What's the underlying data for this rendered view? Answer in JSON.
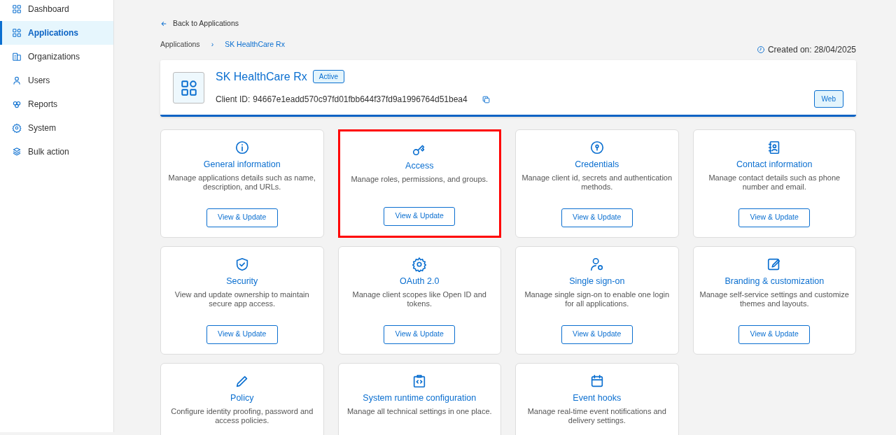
{
  "sidebar": {
    "items": [
      {
        "label": "Dashboard",
        "selected": false
      },
      {
        "label": "Applications",
        "selected": true
      },
      {
        "label": "Organizations",
        "selected": false
      },
      {
        "label": "Users",
        "selected": false
      },
      {
        "label": "Reports",
        "selected": false
      },
      {
        "label": "System",
        "selected": false
      },
      {
        "label": "Bulk action",
        "selected": false
      }
    ]
  },
  "back_link": "Back to Applications",
  "breadcrumb": [
    "Applications",
    "SK HealthCare Rx"
  ],
  "breadcrumb_separator": "›",
  "created_on": "Created on: 28/04/2025",
  "app": {
    "name": "SK HealthCare Rx",
    "status": "Active",
    "client_id_label": "Client ID:",
    "client_id": "94667e1eadd570c97fd01fbb644f37fd9a1996764d51bea4",
    "type": "Web"
  },
  "tiles": [
    {
      "title": "General information",
      "description": "Manage applications details such as name, description, and URLs.",
      "button": "View & Update",
      "highlighted": false
    },
    {
      "title": "Access",
      "description": "Manage roles, permissions, and groups.",
      "button": "View & Update",
      "highlighted": true
    },
    {
      "title": "Credentials",
      "description": "Manage client id, secrets and authentication methods.",
      "button": "View & Update",
      "highlighted": false
    },
    {
      "title": "Contact information",
      "description": "Manage contact details such as phone number and email.",
      "button": "View & Update",
      "highlighted": false
    },
    {
      "title": "Security",
      "description": "View and update ownership to maintain secure app access.",
      "button": "View & Update",
      "highlighted": false
    },
    {
      "title": "OAuth 2.0",
      "description": "Manage client scopes like Open ID and tokens.",
      "button": "View & Update",
      "highlighted": false
    },
    {
      "title": "Single sign-on",
      "description": "Manage single sign-on to enable one login for all applications.",
      "button": "View & Update",
      "highlighted": false
    },
    {
      "title": "Branding & customization",
      "description": "Manage self-service settings and customize themes and layouts.",
      "button": "View & Update",
      "highlighted": false
    },
    {
      "title": "Policy",
      "description": "Configure identity proofing, password and access policies.",
      "highlighted": false
    },
    {
      "title": "System runtime configuration",
      "description": "Manage all technical settings in one place.",
      "highlighted": false
    },
    {
      "title": "Event hooks",
      "description": "Manage real-time event notifications and delivery settings.",
      "highlighted": false
    }
  ]
}
